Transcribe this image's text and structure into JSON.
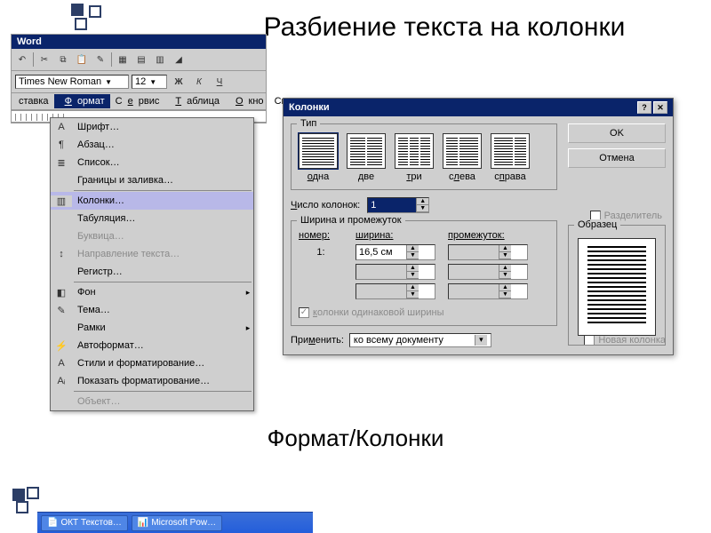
{
  "slide": {
    "title": "Разбиение текста на колонки",
    "footer": "Формат/Колонки"
  },
  "word": {
    "title": "Word",
    "font_name": "Times New Roman",
    "font_size": "12",
    "bold": "Ж",
    "italic": "К",
    "underline": "Ч",
    "menubar": {
      "m1": "ставка",
      "m2": "Формат",
      "m3": "Сервис",
      "m4": "Таблица",
      "m5": "Окно",
      "m6": "Справк"
    }
  },
  "menu": {
    "font": "Шрифт…",
    "paragraph": "Абзац…",
    "list": "Список…",
    "borders": "Границы и заливка…",
    "columns": "Колонки…",
    "tabs": "Табуляция…",
    "dropcap": "Буквица…",
    "textdir": "Направление текста…",
    "case": "Регистр…",
    "bg": "Фон",
    "theme": "Тема…",
    "frames": "Рамки",
    "autoformat": "Автоформат…",
    "styles": "Стили и форматирование…",
    "reveal": "Показать форматирование…",
    "object": "Объект…"
  },
  "dialog": {
    "title": "Колонки",
    "ok": "OK",
    "cancel": "Отмена",
    "group_type": "Тип",
    "types": {
      "one": "одна",
      "two": "две",
      "three": "три",
      "left": "слева",
      "right": "справа"
    },
    "count_label": "Число колонок:",
    "count_value": "1",
    "separator": "Разделитель",
    "group_width": "Ширина и промежуток",
    "hdr_num": "номер:",
    "hdr_width": "ширина:",
    "hdr_gap": "промежуток:",
    "row1_num": "1:",
    "row1_width": "16,5 см",
    "equal": "колонки одинаковой ширины",
    "group_sample": "Образец",
    "apply_label": "Применить:",
    "apply_value": "ко всему документу",
    "newcol": "Новая колонка"
  },
  "taskbar": {
    "item1": "ОКТ Текстов…",
    "item2": "Microsoft Pow…"
  }
}
